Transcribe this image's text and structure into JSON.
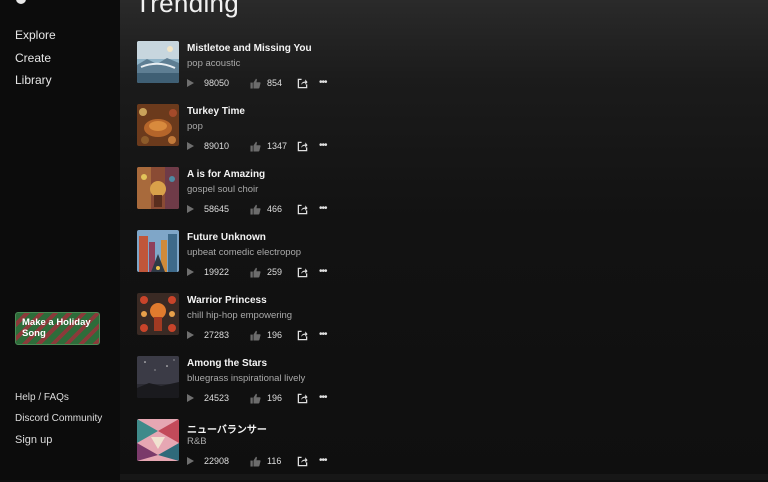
{
  "nav": {
    "explore": "Explore",
    "create": "Create",
    "library": "Library"
  },
  "holiday_button": "Make a Holiday Song",
  "footer": {
    "help": "Help / FAQs",
    "discord": "Discord Community",
    "signup": "Sign up"
  },
  "page_title": "Trending",
  "songs": [
    {
      "title": "Mistletoe and Missing You",
      "genre": "pop acoustic",
      "plays": "98050",
      "likes": "854"
    },
    {
      "title": "Turkey Time",
      "genre": "pop",
      "plays": "89010",
      "likes": "1347"
    },
    {
      "title": "A is for Amazing",
      "genre": "gospel soul choir",
      "plays": "58645",
      "likes": "466"
    },
    {
      "title": "Future Unknown",
      "genre": "upbeat comedic electropop",
      "plays": "19922",
      "likes": "259"
    },
    {
      "title": "Warrior Princess",
      "genre": "chill hip-hop empowering",
      "plays": "27283",
      "likes": "196"
    },
    {
      "title": "Among the Stars",
      "genre": "bluegrass inspirational lively",
      "plays": "24523",
      "likes": "196"
    },
    {
      "title": "ニューバランサー",
      "genre": "R&B",
      "plays": "22908",
      "likes": "116"
    }
  ],
  "icons": {
    "play": "play-icon",
    "like": "thumbs-up-icon",
    "share": "share-icon",
    "more": "more-icon"
  },
  "colors": {
    "accent_green": "#2e6c3a",
    "accent_red": "#8b3a3a"
  }
}
